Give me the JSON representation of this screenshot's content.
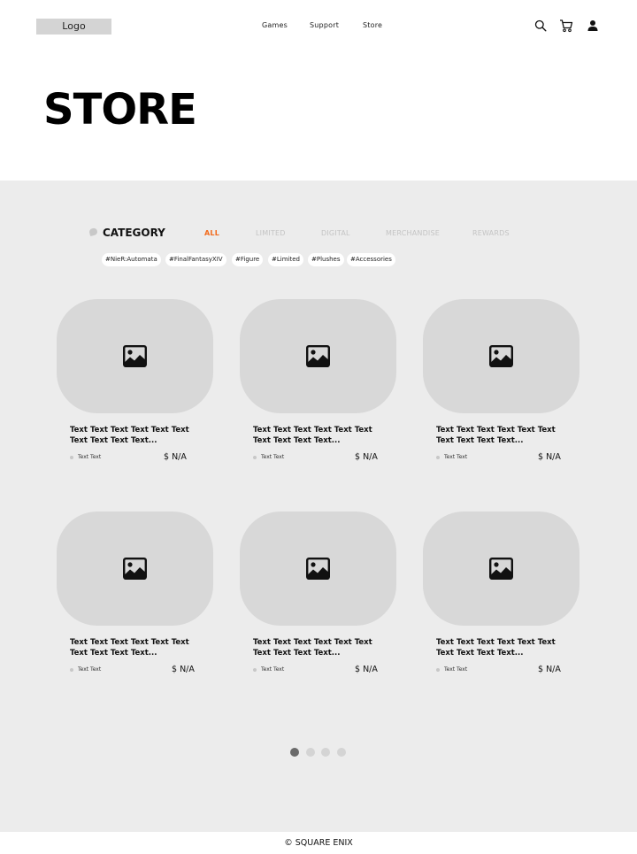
{
  "header": {
    "logo": "Logo",
    "nav": [
      "Games",
      "Support",
      "Store"
    ],
    "icons": [
      "search-icon",
      "cart-icon",
      "user-icon"
    ]
  },
  "page_title": "STORE",
  "category": {
    "label": "CATEGORY",
    "tabs": [
      "ALL",
      "LIMITED",
      "DIGITAL",
      "MERCHANDISE",
      "REWARDS"
    ],
    "active_tab": "ALL",
    "accent_color": "#f26a1b",
    "tags": [
      "#NieR:Automata",
      "#FinalFantasyXIV",
      "#Figure",
      "#Limited",
      "#Plushes",
      "#Accessories"
    ]
  },
  "products": [
    {
      "title": "Text Text Text Text Text Text Text Text Text Text...",
      "meta": "Text Text",
      "price": "$ N/A"
    },
    {
      "title": "Text Text Text Text Text Text Text Text Text Text...",
      "meta": "Text Text",
      "price": "$ N/A"
    },
    {
      "title": "Text Text Text Text Text Text Text Text Text Text...",
      "meta": "Text Text",
      "price": "$ N/A"
    },
    {
      "title": "Text Text Text Text Text Text Text Text Text Text...",
      "meta": "Text Text",
      "price": "$ N/A"
    },
    {
      "title": "Text Text Text Text Text Text Text Text Text Text...",
      "meta": "Text Text",
      "price": "$ N/A"
    },
    {
      "title": "Text Text Text Text Text Text Text Text Text Text...",
      "meta": "Text Text",
      "price": "$ N/A"
    }
  ],
  "pagination": {
    "pages": 4,
    "current": 1
  },
  "footer": "© SQUARE ENIX"
}
